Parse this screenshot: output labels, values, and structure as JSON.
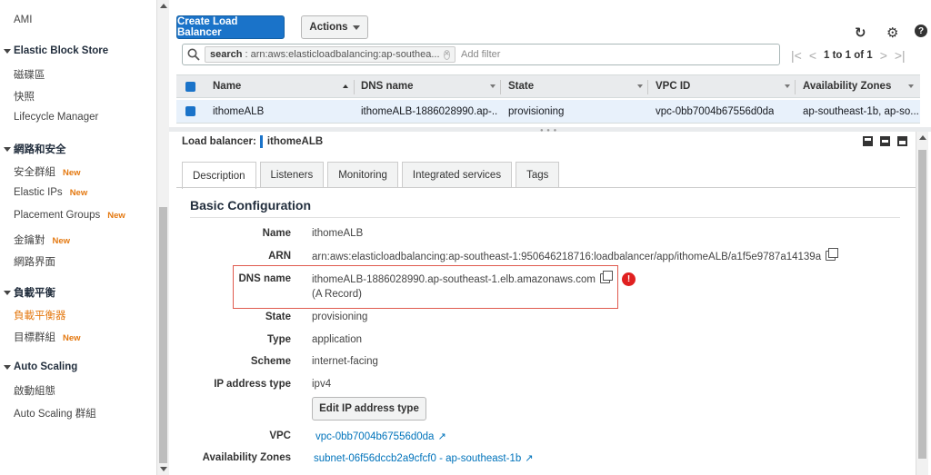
{
  "sidebar": {
    "items": [
      {
        "label": "AMI"
      },
      {
        "label": "Elastic Block Store"
      },
      {
        "label": "磁碟區"
      },
      {
        "label": "快照"
      },
      {
        "label": "Lifecycle Manager"
      },
      {
        "label": "網路和安全"
      },
      {
        "label": "安全群組",
        "badge": "New"
      },
      {
        "label": "Elastic IPs",
        "badge": "New"
      },
      {
        "label": "Placement Groups",
        "badge": "New"
      },
      {
        "label": "金鑰對",
        "badge": "New"
      },
      {
        "label": "網路界面"
      },
      {
        "label": "負載平衡"
      },
      {
        "label": "負載平衡器"
      },
      {
        "label": "目標群組",
        "badge": "New"
      },
      {
        "label": "Auto Scaling"
      },
      {
        "label": "啟動組態"
      },
      {
        "label": "Auto Scaling 群組"
      }
    ]
  },
  "toolbar": {
    "create_label": "Create Load Balancer",
    "actions_label": "Actions",
    "icons": [
      "refresh-icon",
      "gear-icon",
      "help-icon"
    ]
  },
  "filter": {
    "token_key": "search",
    "token_value": ": arn:aws:elasticloadbalancing:ap-southea...",
    "placeholder": "Add filter"
  },
  "pager": {
    "label": "1 to 1 of 1"
  },
  "table": {
    "columns": [
      "Name",
      "DNS name",
      "State",
      "VPC ID",
      "Availability Zones"
    ],
    "rows": [
      [
        "ithomeALB",
        "ithomeALB-1886028990.ap-...",
        "provisioning",
        "vpc-0bb7004b67556d0da",
        "ap-southeast-1b, ap-so..."
      ]
    ]
  },
  "detail": {
    "title_prefix": "Load balancer:",
    "title_name": "ithomeALB",
    "tabs": [
      "Description",
      "Listeners",
      "Monitoring",
      "Integrated services",
      "Tags"
    ],
    "section_title": "Basic Configuration",
    "fields": {
      "name_label": "Name",
      "name_value": "ithomeALB",
      "arn_label": "ARN",
      "arn_value": "arn:aws:elasticloadbalancing:ap-southeast-1:950646218716:loadbalancer/app/ithomeALB/a1f5e9787a14139a",
      "dns_label": "DNS name",
      "dns_value": "ithomeALB-1886028990.ap-southeast-1.elb.amazonaws.com",
      "dns_note": "(A Record)",
      "state_label": "State",
      "state_value": "provisioning",
      "type_label": "Type",
      "type_value": "application",
      "scheme_label": "Scheme",
      "scheme_value": "internet-facing",
      "ipt_label": "IP address type",
      "ipt_value": "ipv4",
      "edit_ipt_label": "Edit IP address type",
      "vpc_label": "VPC",
      "vpc_value": "vpc-0bb7004b67556d0da",
      "az_label": "Availability Zones",
      "az_value": "subnet-06f56dccb2a9cfcf0 - ap-southeast-1b"
    },
    "alert_text": "!"
  }
}
